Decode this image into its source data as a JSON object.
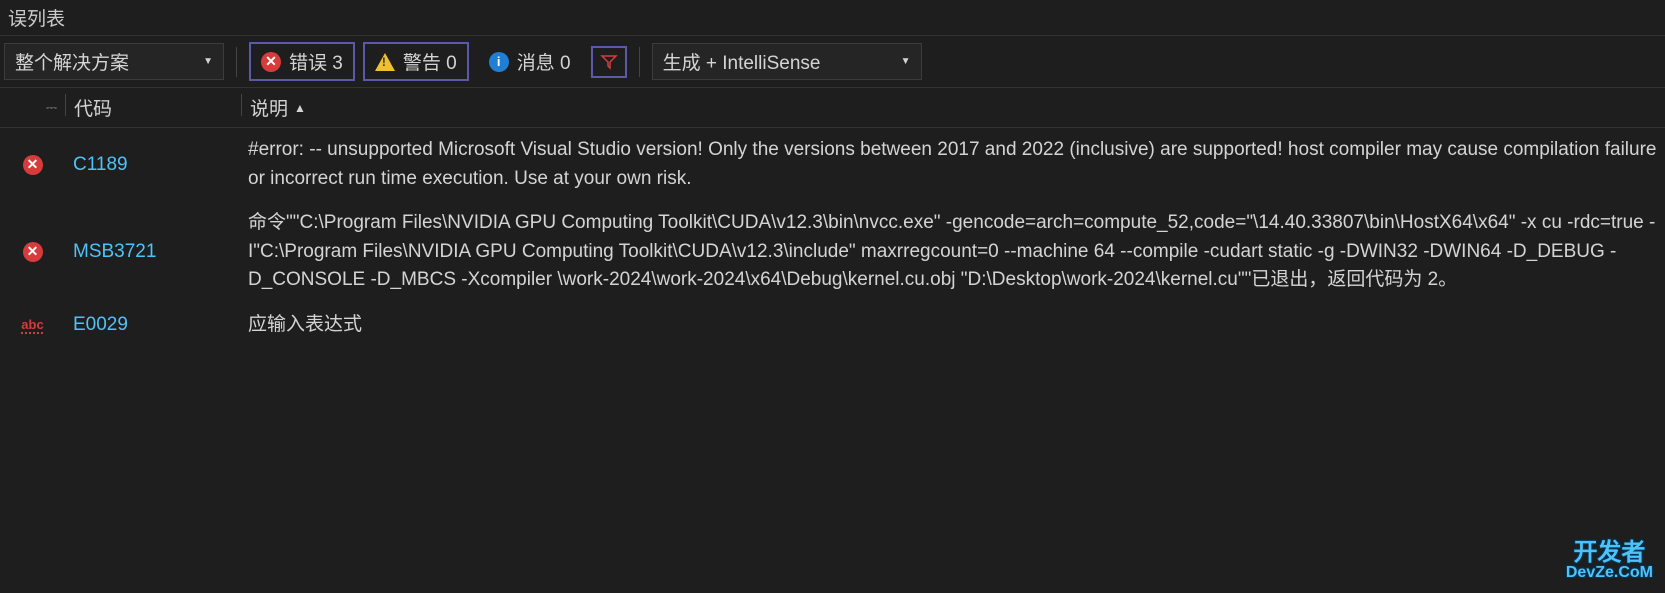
{
  "panel": {
    "title": "误列表"
  },
  "toolbar": {
    "scope": "整个解决方案",
    "errors_label": "错误 3",
    "warnings_label": "警告 0",
    "messages_label": "消息 0",
    "source": "生成 + IntelliSense"
  },
  "headers": {
    "code": "代码",
    "description": "说明"
  },
  "rows": [
    {
      "icon": "error",
      "code": "C1189",
      "description": "#error:  -- unsupported Microsoft Visual Studio version! Only the versions between 2017 and 2022 (inclusive) are supported! host compiler may cause compilation failure or incorrect run time execution. Use at your own risk."
    },
    {
      "icon": "error",
      "code": "MSB3721",
      "description": "命令\"\"C:\\Program Files\\NVIDIA GPU Computing Toolkit\\CUDA\\v12.3\\bin\\nvcc.exe\" -gencode=arch=compute_52,code=\"\\14.40.33807\\bin\\HostX64\\x64\" -x cu -rdc=true  -I\"C:\\Program Files\\NVIDIA GPU Computing Toolkit\\CUDA\\v12.3\\include\" maxrregcount=0   --machine 64 --compile -cudart static  -g  -DWIN32 -DWIN64 -D_DEBUG -D_CONSOLE -D_MBCS -Xcompiler \\work-2024\\work-2024\\x64\\Debug\\kernel.cu.obj \"D:\\Desktop\\work-2024\\kernel.cu\"\"已退出，返回代码为 2。"
    },
    {
      "icon": "abc",
      "code": "E0029",
      "description": "应输入表达式"
    }
  ],
  "watermark": {
    "line1": "开发者",
    "line2": "DevZe.CoM"
  }
}
